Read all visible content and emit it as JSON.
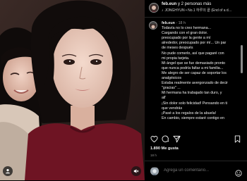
{
  "header": {
    "username": "feb.eun",
    "others": "y 2 personas más",
    "song": "JONGHYUN • No.1 하루의 끝 (End of a d…",
    "avatar_icon": "profile-avatar-icon"
  },
  "caption": {
    "username": "feb.eun",
    "time": "18 h",
    "first_line": "Todavía no lo creo hermana...",
    "lines": [
      "Cargando con el gran dolor.",
      "preocupado por la gente a mí",
      "alrededor, preocupado por mí... Un par",
      "de meses después",
      "No pude comerlo, así que pagaré con",
      "mi propia tarjeta.",
      "Mi ángel que se fue demasiado pronto",
      "que nunca podría faltar a mi familia...",
      "Me alegro de ser capaz de soportar los",
      "analgésicos",
      "Estaba realmente avergonzado de decir",
      "\"gracias\" ...",
      "Mi hermana ha trabajado tan duro, y",
      "all'",
      "¡Sin dolor solo felicidad! Pensando en ti",
      "que vendrás",
      "¡Pasé a los regalos de la abuela!",
      "En cambio, siempre estaré contigo en"
    ]
  },
  "actions": {
    "like_icon": "heart-icon",
    "comment_icon": "comment-icon",
    "share_icon": "send-icon",
    "save_icon": "bookmark-icon"
  },
  "likes": "1.890 Me gusta",
  "date": "18 h",
  "comment": {
    "placeholder": "Agrega un comentario..."
  },
  "photo": {
    "user_tag_icon": "user-tag-icon",
    "mute_icon": "muted-speaker-icon"
  },
  "colors": {
    "background": "#000000",
    "text": "#f5f5f5",
    "muted": "#8e8e8e",
    "sweater": "#6e1423"
  }
}
